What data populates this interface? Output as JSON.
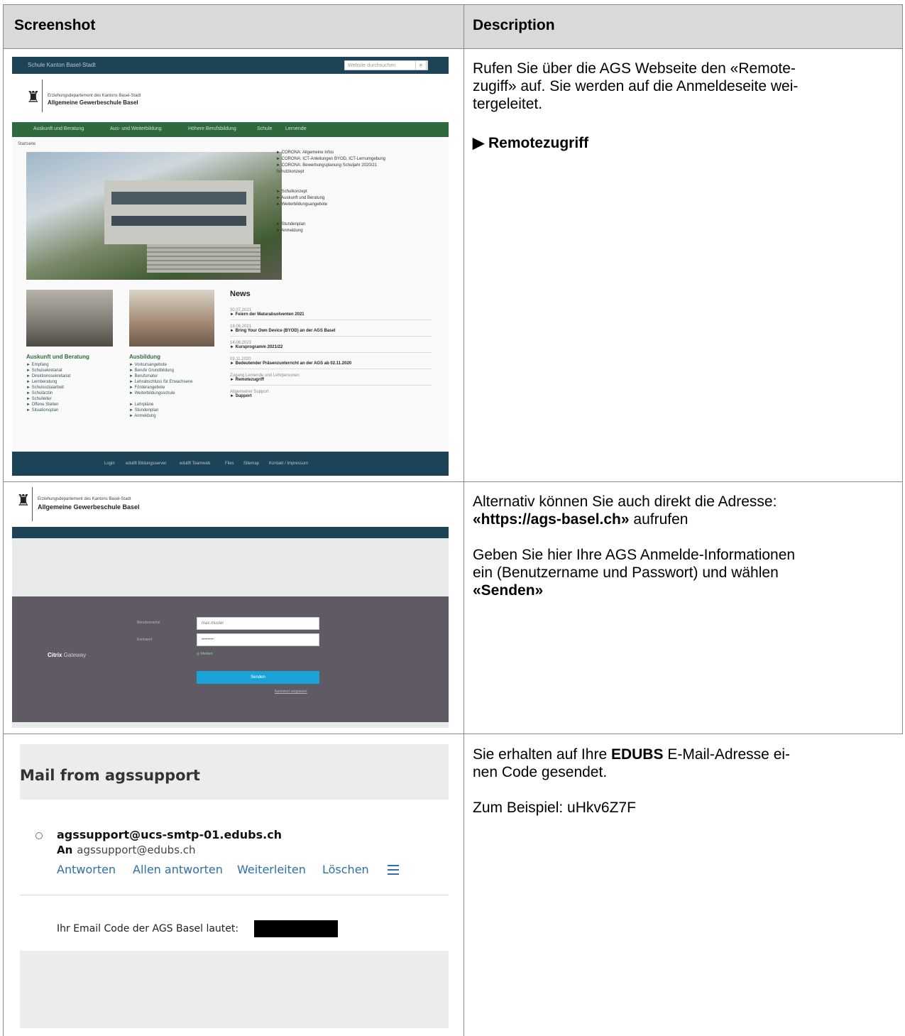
{
  "table": {
    "header_screenshot": "Screenshot",
    "header_description": "Description"
  },
  "rows": [
    {
      "desc_lines": [
        "Rufen Sie über die AGS Webseite den «Remote-",
        "zugiff» auf. Sie werden auf die Anmeldeseite wei-",
        "tergeleitet."
      ],
      "link": "▶ Remotezugriff"
    },
    {
      "desc_line1": "Alternativ können Sie auch direkt die Adresse:",
      "desc_url": "«https://ags-basel.ch»",
      "desc_url_suffix": " aufrufen",
      "desc_p2_lines": [
        "Geben Sie hier Ihre AGS Anmelde-Informationen",
        "ein (Benutzername und Passwort) und wählen"
      ],
      "desc_p2_bold": "«Senden»"
    },
    {
      "desc_prefix": "Sie erhalten auf Ihre ",
      "desc_bold": "EDUBS",
      "desc_suffix": " E-Mail-Adresse ei-",
      "desc_line2": "nen Code gesendet.",
      "example": "Zum Beispiel: uHkv6Z7F"
    }
  ],
  "shot_website": {
    "brand": "Schule Kanton Basel-Stadt",
    "search_placeholder": "Website durchsuchen",
    "department": "Erziehungsdepartement des Kantons Basel-Stadt",
    "school": "Allgemeine Gewerbeschule Basel",
    "nav": [
      "Auskunft und Beratung",
      "Aus- und Weiterbildung",
      "Höhere Berufsbildung",
      "Schule",
      "Lernende"
    ],
    "crumb": "Startseite",
    "links": [
      "► CORONA: Allgemeine Infos",
      "► CORONA: ICT-Anleitungen BYOD, ICT-Lernumgebung",
      "► CORONA: Bewerbungsplanung Schuljahr 2020/21",
      "Schutzkonzept",
      "► Schulkonzept",
      "► Auskunft und Beratung",
      "► Weiterbildungsangebote",
      "► Stundenplan",
      "► Anmeldung"
    ],
    "col1_title": "Auskunft und Beratung",
    "col1": [
      "► Empfang",
      "► Schulsekretariat",
      "► Direktionssekretariat",
      "► Lernberatung",
      "► Schulsozialarbeit",
      "► Schulärztin",
      "► Schulleiter",
      "► Offene Stellen",
      "► Situationsplan"
    ],
    "col2_title": "Ausbildung",
    "col2": [
      "► Vorkursangebote",
      "► Berufe Grundbildung",
      "► Berufsmatur",
      "► Lehrabschluss für Erwachsene",
      "► Förderangebote",
      "► Weiterbildungsschule",
      "► Lehrpläne",
      "► Stundenplan",
      "► Anmeldung"
    ],
    "news_title": "News",
    "news": [
      {
        "date": "30.07.2021",
        "title": "► Feiern der Maturabsolventen 2021"
      },
      {
        "date": "18.06.2021",
        "title": "► Bring Your Own Device (BYOD) an der AGS Basel"
      },
      {
        "date": "14.06.2021",
        "title": "► Kursprogramm 2021/22"
      },
      {
        "date": "03.11.2020",
        "title": "► Bedeutender Präsenzunterricht an der AGS ab 02.11.2020"
      },
      {
        "date": "Zugang Lernende und Lehrpersonen",
        "title": "► Remotezugriff"
      },
      {
        "date": "Allgemeiner Support",
        "title": "► Support"
      }
    ],
    "footer": [
      "Login",
      "edulift Bildungsserver",
      "edulift Teamweb",
      "Files",
      "Sitemap",
      "Kontakt / Impressum"
    ]
  },
  "shot_login": {
    "department": "Erziehungsdepartement des Kantons Basel-Stadt",
    "school": "Allgemeine Gewerbeschule Basel",
    "brand_bold": "Citrix",
    "brand_rest": " Gateway",
    "label_user": "Benutzername",
    "label_pass": "Kennwort",
    "user_value": "max.muster",
    "pass_value": "••••••••",
    "remember": "Merken",
    "submit": "Senden",
    "forgot": "Kennwort vergessen"
  },
  "shot_mail": {
    "title": "Mail from agssupport",
    "from": "agssupport@ucs-smtp-01.edubs.ch",
    "to_label": "An",
    "to": "agssupport@edubs.ch",
    "actions": [
      "Antworten",
      "Allen antworten",
      "Weiterleiten",
      "Löschen"
    ],
    "body": "Ihr Email Code der AGS Basel lautet:"
  },
  "colors": {
    "header_bg": "#d9d9d9",
    "site_dark": "#1d4356",
    "site_green": "#2e6a3d",
    "login_panel": "#605a64",
    "login_button": "#1aa3d6",
    "mail_link": "#2a6fb3"
  }
}
